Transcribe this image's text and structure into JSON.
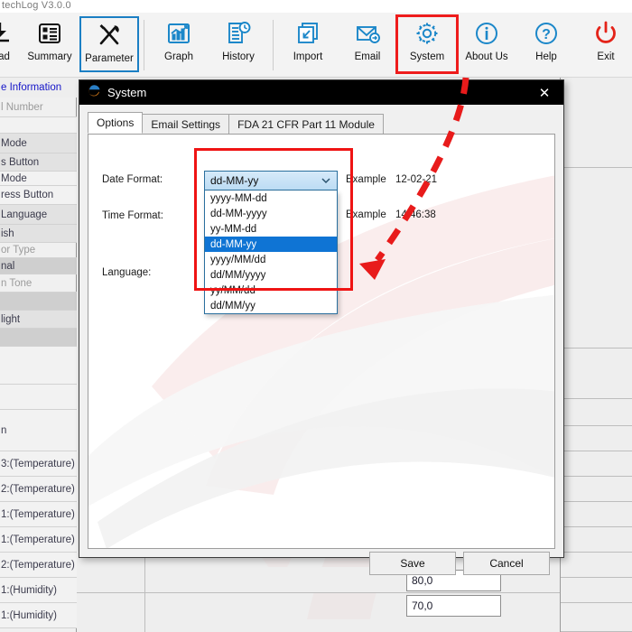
{
  "app": {
    "title": "techLog V3.0.0"
  },
  "toolbar": {
    "items": [
      {
        "label": "load",
        "icon": "download-icon",
        "state": "normal"
      },
      {
        "label": "Summary",
        "icon": "summary-icon",
        "state": "normal"
      },
      {
        "label": "Parameter",
        "icon": "parameter-icon",
        "state": "selected"
      },
      {
        "label": "Graph",
        "icon": "graph-icon",
        "state": "normal"
      },
      {
        "label": "History",
        "icon": "history-icon",
        "state": "normal"
      },
      {
        "label": "Import",
        "icon": "import-icon",
        "state": "normal"
      },
      {
        "label": "Email",
        "icon": "email-icon",
        "state": "normal"
      },
      {
        "label": "System",
        "icon": "gear-icon",
        "state": "highlighted"
      },
      {
        "label": "About Us",
        "icon": "info-icon",
        "state": "normal"
      },
      {
        "label": "Help",
        "icon": "question-icon",
        "state": "normal"
      },
      {
        "label": "Exit",
        "icon": "power-icon",
        "state": "normal"
      }
    ],
    "accent": "#1b87c9",
    "exit_color": "#e42319",
    "highlight_color": "#ee1c1c",
    "selected_border": "#1b7fc4"
  },
  "background_grid": {
    "left_labels": [
      "e Information",
      "l Number",
      "",
      "Mode",
      "s Button",
      "Mode",
      "ress Button",
      "Language",
      "ish",
      "or Type",
      "nal",
      "n Tone",
      "",
      "light",
      "",
      "",
      "",
      "n",
      "3:(Temperature)",
      "2:(Temperature)",
      "1:(Temperature)",
      "1:(Temperature)",
      "2:(Temperature)",
      "1:(Humidity)",
      "1:(Humidity)"
    ],
    "field_values": [
      "80,0",
      "70,0"
    ]
  },
  "dialog": {
    "title": "System",
    "title_icon": "e-logo-icon",
    "close_icon": "close-icon",
    "tabs": [
      {
        "label": "Options",
        "active": true
      },
      {
        "label": "Email Settings",
        "active": false
      },
      {
        "label": "FDA 21 CFR Part 11 Module",
        "active": false
      }
    ],
    "form": {
      "date_format_label": "Date Format:",
      "time_format_label": "Time Format:",
      "language_label": "Language:",
      "date_example_label": "Example",
      "date_example_value": "12-02-21",
      "time_example_label": "Example",
      "time_example_value": "14:46:38"
    },
    "date_format_combo": {
      "value": "dd-MM-yy",
      "expanded": true,
      "chevron_icon": "chevron-down-icon",
      "options": [
        "yyyy-MM-dd",
        "dd-MM-yyyy",
        "yy-MM-dd",
        "dd-MM-yy",
        "yyyy/MM/dd",
        "dd/MM/yyyy",
        "yy/MM/dd",
        "dd/MM/yy"
      ],
      "selected_index": 3,
      "selected_bg": "#0f74d4"
    },
    "buttons": {
      "save_label": "Save",
      "cancel_label": "Cancel"
    }
  },
  "annotation": {
    "box_color": "#ef1414",
    "arrow_color": "#e81b1b",
    "type": "dashed-arrow"
  }
}
